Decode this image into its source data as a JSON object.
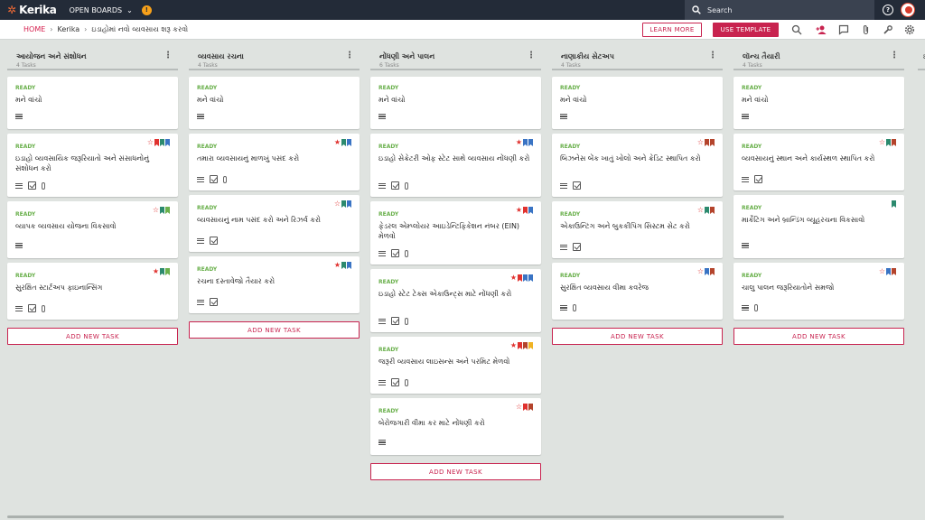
{
  "topbar": {
    "app_name": "Kerika",
    "open_boards_label": "OPEN BOARDS",
    "notification_count": "!",
    "search_placeholder": "Search"
  },
  "breadcrumb": {
    "home": "HOME",
    "items": [
      "Kerika",
      "ઇડાહોમાં નવો વ્યવસાય શરૂ કરવો"
    ]
  },
  "toolbar": {
    "learn_more_label": "LEARN MORE",
    "use_template_label": "USE TEMPLATE"
  },
  "colors": {
    "accent": "#c8234f",
    "ready": "#6ab04c",
    "topbar": "#232b38"
  },
  "columns": [
    {
      "title": "આયોજન અને સંશોધન",
      "count": "4 Tasks",
      "add_label": "ADD NEW TASK",
      "cards": [
        {
          "status": "READY",
          "title": "મને વાંચો",
          "icons": [
            "lines"
          ],
          "flags": []
        },
        {
          "status": "READY",
          "title": "ઇડાહો વ્યવસાયિક જરૂરિયાતો અને સંસાધનોનું સંશોધન કરો",
          "icons": [
            "lines",
            "check",
            "clip"
          ],
          "flags": [
            "star-hollow",
            "#e0322f",
            "#2c8a6e",
            "#3a74c4"
          ]
        },
        {
          "status": "READY",
          "title": "વ્યાપક વ્યવસાય યોજના વિકસાવો",
          "icons": [
            "lines"
          ],
          "flags": [
            "star-hollow",
            "#2c8a6e",
            "#6ab04c"
          ]
        },
        {
          "status": "READY",
          "title": "સુરક્ષિત સ્ટાર્ટઅપ ફાઇનાન્સિંગ",
          "icons": [
            "lines",
            "check",
            "clip"
          ],
          "flags": [
            "star-filled",
            "#2c8a6e",
            "#6ab04c"
          ]
        }
      ]
    },
    {
      "title": "વ્યવસાય રચના",
      "count": "4 Tasks",
      "add_label": "ADD NEW TASK",
      "cards": [
        {
          "status": "READY",
          "title": "મને વાંચો",
          "icons": [
            "lines"
          ],
          "flags": []
        },
        {
          "status": "READY",
          "title": "તમારા વ્યવસાયનું માળખું પસંદ કરો",
          "icons": [
            "lines",
            "check",
            "clip"
          ],
          "flags": [
            "star-filled",
            "#2c8a6e",
            "#3a74c4"
          ]
        },
        {
          "status": "READY",
          "title": "વ્યવસાયનું નામ પસંદ કરો અને રિઝર્વ કરો",
          "icons": [
            "lines",
            "check"
          ],
          "flags": [
            "star-hollow",
            "#2c8a6e",
            "#3a74c4"
          ]
        },
        {
          "status": "READY",
          "title": "રચના દસ્તાવેજો તૈયાર કરો",
          "icons": [
            "lines",
            "check"
          ],
          "flags": [
            "star-filled",
            "#2c8a6e",
            "#3a74c4"
          ]
        }
      ]
    },
    {
      "title": "નોંધણી અને પાલન",
      "count": "6 Tasks",
      "add_label": "ADD NEW TASK",
      "cards": [
        {
          "status": "READY",
          "title": "મને વાંચો",
          "icons": [
            "lines"
          ],
          "flags": []
        },
        {
          "status": "READY",
          "title": "ઇડાહો સેક્રેટરી ઓફ સ્ટેટ સાથે વ્યવસાય નોંધણી કરો",
          "icons": [
            "lines",
            "check",
            "clip"
          ],
          "flags": [
            "star-filled",
            "#3a74c4",
            "#3a74c4"
          ]
        },
        {
          "status": "READY",
          "title": "ફેડરલ એમ્પ્લોયર આઇડેન્ટિફિકેશન નંબર (EIN) મેળવો",
          "icons": [
            "lines",
            "check",
            "clip"
          ],
          "flags": [
            "star-filled",
            "#e0322f",
            "#3a74c4"
          ]
        },
        {
          "status": "READY",
          "title": "ઇડાહો સ્ટેટ ટેક્સ એકાઉન્ટ્સ માટે નોંધણી કરો",
          "icons": [
            "lines",
            "check",
            "clip"
          ],
          "flags": [
            "star-filled",
            "#e0322f",
            "#3a74c4",
            "#3a74c4"
          ]
        },
        {
          "status": "READY",
          "title": "જરૂરી વ્યવસાય લાઇસન્સ અને પરમિટ મેળવો",
          "icons": [
            "lines",
            "check",
            "clip"
          ],
          "flags": [
            "star-filled",
            "#e0322f",
            "#b4442c",
            "#f0b323"
          ]
        },
        {
          "status": "READY",
          "title": "બેરોજગારી વીમા કર માટે નોંધણી કરો",
          "icons": [
            "lines"
          ],
          "flags": [
            "star-hollow",
            "#e0322f",
            "#b4442c"
          ]
        }
      ]
    },
    {
      "title": "નાણાકીય સેટઅપ",
      "count": "4 Tasks",
      "add_label": "ADD NEW TASK",
      "cards": [
        {
          "status": "READY",
          "title": "મને વાંચો",
          "icons": [
            "lines"
          ],
          "flags": []
        },
        {
          "status": "READY",
          "title": "બિઝનેસ બેંક ખાતું ખોલો અને ક્રેડિટ સ્થાપિત કરો",
          "icons": [
            "lines",
            "check"
          ],
          "flags": [
            "star-hollow",
            "#b4442c",
            "#b4442c"
          ]
        },
        {
          "status": "READY",
          "title": "એકાઉન્ટિંગ અને બુકકીપિંગ સિસ્ટમ સેટ કરો",
          "icons": [
            "lines",
            "check"
          ],
          "flags": [
            "star-hollow",
            "#2c8a6e",
            "#b4442c"
          ]
        },
        {
          "status": "READY",
          "title": "સુરક્ષિત વ્યવસાય વીમા કવરેજ",
          "icons": [
            "lines",
            "clip"
          ],
          "flags": [
            "star-hollow",
            "#3a74c4",
            "#b4442c"
          ]
        }
      ]
    },
    {
      "title": "લૉન્ચ તૈયારી",
      "count": "4 Tasks",
      "add_label": "ADD NEW TASK",
      "cards": [
        {
          "status": "READY",
          "title": "મને વાંચો",
          "icons": [
            "lines"
          ],
          "flags": []
        },
        {
          "status": "READY",
          "title": "વ્યવસાયનું સ્થાન અને કાર્યસ્થળ સ્થાપિત કરો",
          "icons": [
            "lines",
            "check"
          ],
          "flags": [
            "star-hollow",
            "#2c8a6e",
            "#b4442c"
          ]
        },
        {
          "status": "READY",
          "title": "માર્કેટિંગ અને બ્રાન્ડિંગ વ્યૂહરચના વિકસાવો",
          "icons": [
            "lines"
          ],
          "flags": [
            "#2c8a6e"
          ]
        },
        {
          "status": "READY",
          "title": "ચાલુ પાલન જરૂરિયાતોને સમજો",
          "icons": [
            "lines",
            "clip"
          ],
          "flags": [
            "star-hollow",
            "#3a74c4",
            "#b4442c"
          ]
        }
      ]
    }
  ]
}
